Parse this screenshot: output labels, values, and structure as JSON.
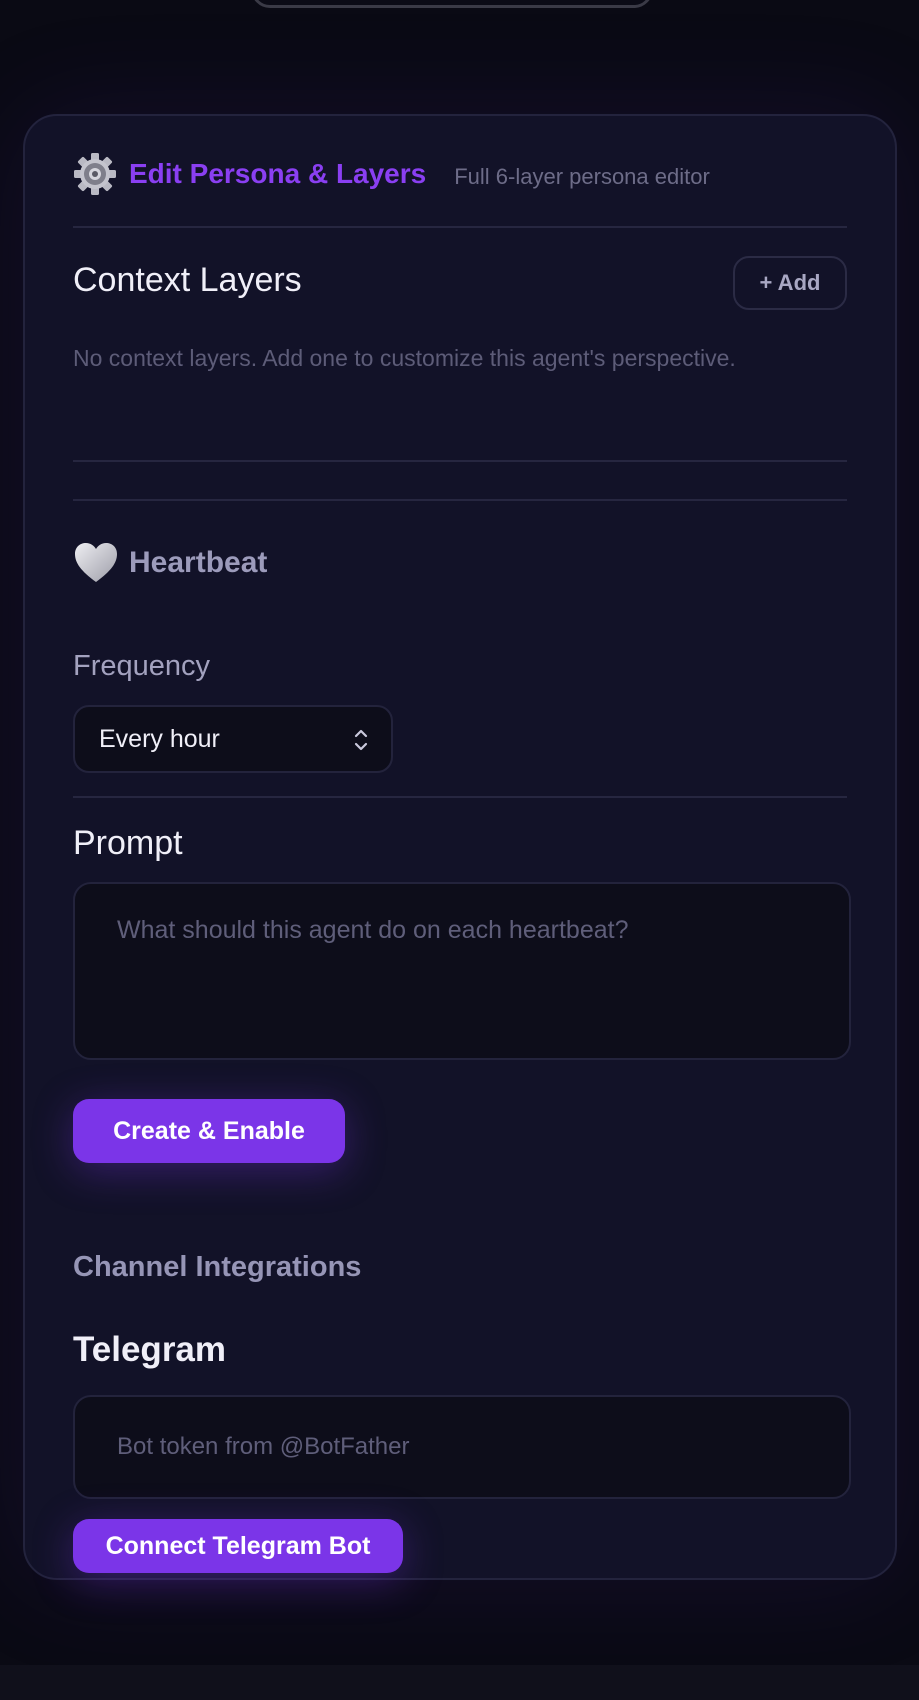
{
  "header": {
    "title": "Edit Persona & Layers",
    "subtitle": "Full 6-layer persona editor",
    "icon": "gear-icon"
  },
  "context_layers": {
    "title": "Context Layers",
    "add_label": "+ Add",
    "empty_text": "No context layers. Add one to customize this agent's perspective."
  },
  "heartbeat": {
    "icon": "heart-icon",
    "title": "Heartbeat",
    "frequency_label": "Frequency",
    "frequency_value": "Every hour",
    "prompt_label": "Prompt",
    "prompt_placeholder": "What should this agent do on each heartbeat?",
    "create_label": "Create & Enable"
  },
  "channels": {
    "title": "Channel Integrations",
    "telegram_title": "Telegram",
    "token_placeholder": "Bot token from @BotFather",
    "connect_label": "Connect Telegram Bot"
  },
  "colors": {
    "accent": "#7b35e8",
    "background": "#0a0a14",
    "card": "#121228"
  }
}
